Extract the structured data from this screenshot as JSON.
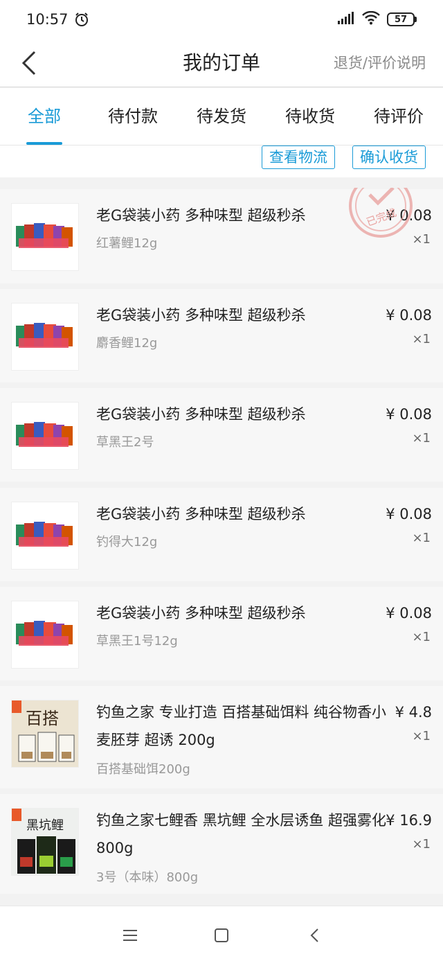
{
  "status_bar": {
    "time": "10:57",
    "battery": "57"
  },
  "header": {
    "title": "我的订单",
    "link": "退货/评价说明"
  },
  "tabs": [
    {
      "label": "全部",
      "active": true
    },
    {
      "label": "待付款",
      "active": false
    },
    {
      "label": "待发货",
      "active": false
    },
    {
      "label": "待收货",
      "active": false
    },
    {
      "label": "待评价",
      "active": false
    }
  ],
  "actions": {
    "logistics": "查看物流",
    "confirm": "确认收货"
  },
  "stamp_text": "已完成",
  "items": [
    {
      "title": "老G袋装小药 多种味型 超级秒杀",
      "variant": "红薯鲤12g",
      "price": "¥ 0.08",
      "qty": "×1"
    },
    {
      "title": "老G袋装小药 多种味型 超级秒杀",
      "variant": "麝香鲤12g",
      "price": "¥ 0.08",
      "qty": "×1"
    },
    {
      "title": "老G袋装小药 多种味型 超级秒杀",
      "variant": "草黑王2号",
      "price": "¥ 0.08",
      "qty": "×1"
    },
    {
      "title": "老G袋装小药 多种味型 超级秒杀",
      "variant": "钓得大12g",
      "price": "¥ 0.08",
      "qty": "×1"
    },
    {
      "title": "老G袋装小药 多种味型 超级秒杀",
      "variant": "草黑王1号12g",
      "price": "¥ 0.08",
      "qty": "×1"
    },
    {
      "title": "钓鱼之家 专业打造 百搭基础饵料  纯谷物香小麦胚芽 超诱 200g",
      "variant": "百搭基础饵200g",
      "price": "¥ 4.8",
      "qty": "×1",
      "thumb_text": "百搭"
    },
    {
      "title": "钓鱼之家七鲤香 黑坑鲤 全水层诱鱼 超强雾化800g",
      "variant": "3号（本味）800g",
      "price": "¥ 16.9",
      "qty": "×1",
      "thumb_text": "黑坑鲤"
    }
  ]
}
